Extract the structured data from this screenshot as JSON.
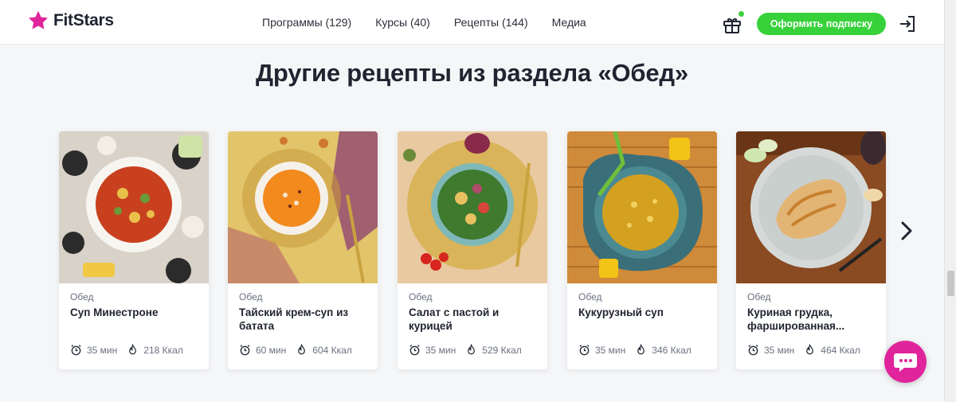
{
  "header": {
    "logo_text": "FitStars",
    "nav": [
      {
        "label": "Программы (129)"
      },
      {
        "label": "Курсы (40)"
      },
      {
        "label": "Рецепты (144)"
      },
      {
        "label": "Медиа"
      }
    ],
    "subscribe_label": "Оформить подписку",
    "icons": {
      "gift": "gift-icon",
      "login": "login-icon"
    }
  },
  "section": {
    "title": "Другие рецепты из раздела «Обед»"
  },
  "cards": [
    {
      "category": "Обед",
      "title": "Суп Минестроне",
      "time": "35 мин",
      "kcal": "218 Ккал"
    },
    {
      "category": "Обед",
      "title": "Тайский крем-суп из батата",
      "time": "60 мин",
      "kcal": "604 Ккал"
    },
    {
      "category": "Обед",
      "title": "Салат с пастой и курицей",
      "time": "35 мин",
      "kcal": "529 Ккал"
    },
    {
      "category": "Обед",
      "title": "Кукурузный суп",
      "time": "35 мин",
      "kcal": "346 Ккал"
    },
    {
      "category": "Обед",
      "title": "Куриная грудка, фаршированная...",
      "time": "35 мин",
      "kcal": "464 Ккал"
    }
  ],
  "colors": {
    "brand_pink": "#e0249b",
    "accent_green": "#37d13a",
    "text_dark": "#1f2430",
    "text_muted": "#6b7180"
  }
}
